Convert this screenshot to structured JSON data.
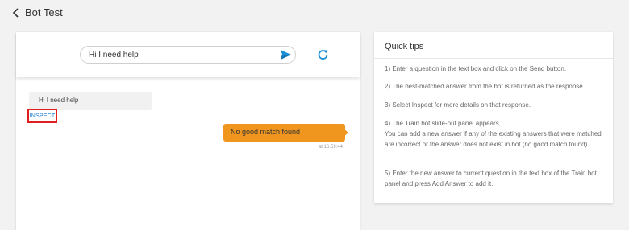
{
  "header": {
    "title": "Bot Test",
    "back_icon": "chevron-left-icon"
  },
  "chat_input": {
    "value": "Hi I need help",
    "send_icon": "send-icon",
    "refresh_icon": "refresh-icon"
  },
  "conversation": {
    "user_message": "Hi I need help",
    "inspect_label": "INSPECT",
    "bot_message": "No good match found",
    "bot_time": "at 16:59:44"
  },
  "tips": {
    "title": "Quick tips",
    "items": [
      "1) Enter a question in the text box and click on the Send button.",
      "2) The best-matched answer from the bot is returned as the response.",
      "3) Select Inspect for more details on that response.",
      "4) The Train bot slide-out panel appears.",
      "You can add a new answer if any of the existing answers that were matched are incorrect or the answer does not exist in bot (no good match found).",
      "5) Enter the new answer to current question in the text box of the Train bot panel and press Add Answer to add it."
    ]
  },
  "colors": {
    "accent_blue": "#1a90d8",
    "bot_bubble": "#f0961e",
    "highlight_red": "#e02020"
  }
}
